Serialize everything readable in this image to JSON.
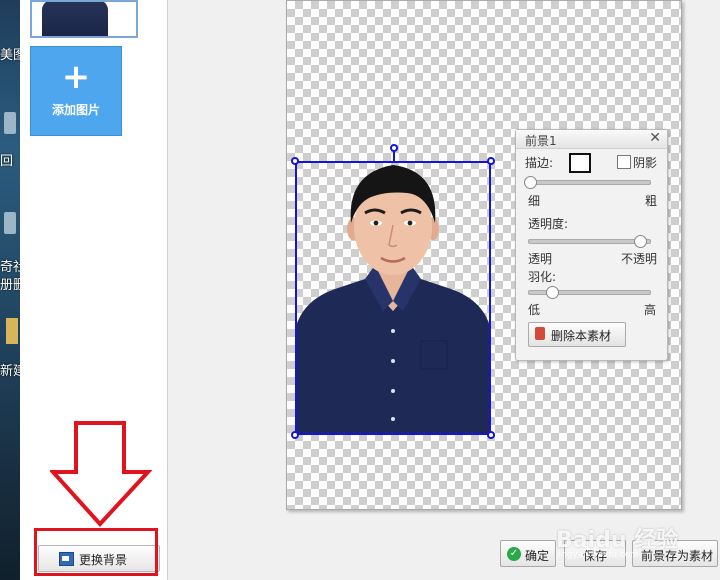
{
  "desktop": {
    "items": [
      {
        "label": "美图"
      },
      {
        "label": "回"
      },
      {
        "label": "奇社"
      },
      {
        "label": "册删"
      },
      {
        "label": "新建"
      }
    ]
  },
  "left_panel": {
    "add_image_label": "添加图片",
    "add_image_icon": "plus-icon",
    "change_background_label": "更换背景",
    "change_background_icon": "image-icon"
  },
  "properties": {
    "title": "前景1",
    "close_glyph": "✕",
    "stroke_label": "描边:",
    "shadow_label": "阴影",
    "stroke_thin": "细",
    "stroke_thick": "粗",
    "stroke_value": 0.0,
    "opacity_label": "透明度:",
    "opacity_transparent": "透明",
    "opacity_opaque": "不透明",
    "opacity_value": 1.0,
    "feather_label": "羽化:",
    "feather_low": "低",
    "feather_high": "高",
    "feather_value": 0.2,
    "delete_label": "删除本素材",
    "delete_icon": "trash-icon"
  },
  "footer": {
    "confirm_label": "确定",
    "confirm_icon": "check-icon",
    "save_label": "保存",
    "save_foreground_label": "前景存为素材"
  },
  "watermark": {
    "text": "Baidu 经验",
    "subtext": "jingyan.baidu.com"
  },
  "colors": {
    "accent": "#4ea6ef",
    "selection": "#1515d8",
    "annotation_red": "#e0141e",
    "shirt": "#1e2a55"
  }
}
